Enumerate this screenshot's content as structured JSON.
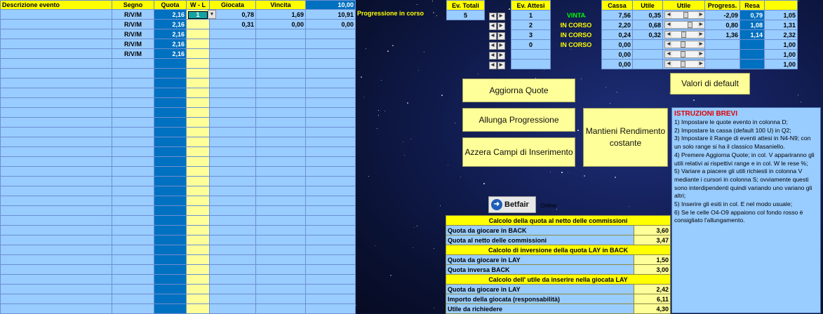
{
  "headers": {
    "descrizione": "Descrizione evento",
    "segno": "Segno",
    "quota": "Quota",
    "wl": "W - L",
    "giocata": "Giocata",
    "vincita": "Vincita",
    "totale": "10,00"
  },
  "rows": [
    {
      "segno": "R/V/M",
      "quota": "2,16",
      "wl": "1",
      "giocata": "0,78",
      "vincita": "1,69",
      "totale": "10,91"
    },
    {
      "segno": "R/V/M",
      "quota": "2,16",
      "wl": "",
      "giocata": "0,31",
      "vincita": "0,00",
      "totale": "0,00"
    },
    {
      "segno": "R/V/M",
      "quota": "2,16",
      "wl": "",
      "giocata": "",
      "vincita": "",
      "totale": ""
    },
    {
      "segno": "R/V/M",
      "quota": "2,16",
      "wl": "",
      "giocata": "",
      "vincita": "",
      "totale": ""
    },
    {
      "segno": "R/V/M",
      "quota": "2,16",
      "wl": "",
      "giocata": "",
      "vincita": "",
      "totale": ""
    }
  ],
  "progress_label": "Progressione in corso",
  "ev_headers": {
    "ev_totali": "Ev. Totali",
    "ev_attesi": "Ev. Attesi",
    "cassa": "Cassa",
    "utile": "Utile",
    "utile2": "Utile",
    "progress": "Progress.",
    "resa": "Resa"
  },
  "ev_totali_value": "5",
  "ev_rows": [
    {
      "attesi": "1",
      "status": "VINTA",
      "cassa": "7,56",
      "utile": "0,35",
      "progress": "-2,09",
      "resa": "0,79",
      "last": "1,05",
      "slider": 0.55
    },
    {
      "attesi": "2",
      "status": "IN CORSO",
      "cassa": "2,20",
      "utile": "0,68",
      "progress": "0,80",
      "resa": "1,08",
      "last": "1,31",
      "slider": 0.75
    },
    {
      "attesi": "3",
      "status": "IN CORSO",
      "cassa": "0,24",
      "utile": "0,32",
      "progress": "1,36",
      "resa": "1,14",
      "last": "2,32",
      "slider": 0.45
    },
    {
      "attesi": "0",
      "status": "IN CORSO",
      "cassa": "0,00",
      "utile": "",
      "progress": "",
      "resa": "",
      "last": "1,00",
      "slider": 0.4
    },
    {
      "attesi": "",
      "status": "",
      "cassa": "0,00",
      "utile": "",
      "progress": "",
      "resa": "",
      "last": "1,00",
      "slider": 0.4
    },
    {
      "attesi": "",
      "status": "",
      "cassa": "0,00",
      "utile": "",
      "progress": "",
      "resa": "",
      "last": "1,00",
      "slider": 0.4
    }
  ],
  "status_colors": {
    "VINTA": "#00ff00",
    "IN CORSO": "#ffff00"
  },
  "buttons": {
    "aggiorna": "Aggiorna Quote",
    "allunga": "Allunga Progressione",
    "azzera": "Azzera Campi di Inserimento",
    "mantieni": "Mantieni Rendimento costante",
    "default": "Valori di default"
  },
  "instructions": {
    "title": "ISTRUZIONI BREVI",
    "items": [
      "1) Impostare le quote evento in colonna D;",
      "2) Impostare la cassa  (default 100 U) in Q2;",
      "3) Impostare il Range di eventi attesi in N4-N9; con un solo range si ha il classico Masaniello.",
      "4) Premere Aggiorna Quote; in col. V appariranno  gli utili relativi ai rispettivi range e in col. W le rese %;",
      "5) Variare a piacere gli utili richiesti in colonna V mediante i cursori in colonna S; ovviamente questi sono interdipendenti quindi variando  uno variano  gli altri;",
      "5) Inserire gli esiti in col. E nel modo usuale;",
      "6) Se le celle O4-O9 appaiono  col fondo rosso è consigliato l'allungamento."
    ]
  },
  "betfair": {
    "label": "Betfair",
    "online": "Online"
  },
  "calc": {
    "sec1_title": "Calcolo della quota al netto delle commissioni",
    "back_label": "Quota da giocare in BACK",
    "back_value": "3,60",
    "netto_label": "Quota al netto delle commissioni",
    "netto_value": "3,47",
    "sec2_title": "Calcolo di inversione della quota LAY in BACK",
    "lay_label": "Quota da giocare in LAY",
    "lay_value": "1,50",
    "inversa_label": "Quota inversa  BACK",
    "inversa_value": "3,00",
    "sec3_title": "Calcolo dell' utile da inserire nella giocata LAY",
    "lay2_label": "Quota da giocare in LAY",
    "lay2_value": "2,42",
    "importo_label": "Importo della giocata (responsabilità)",
    "importo_value": "6,11",
    "utile_label": "Utile da richiedere",
    "utile_value": "4,30"
  }
}
